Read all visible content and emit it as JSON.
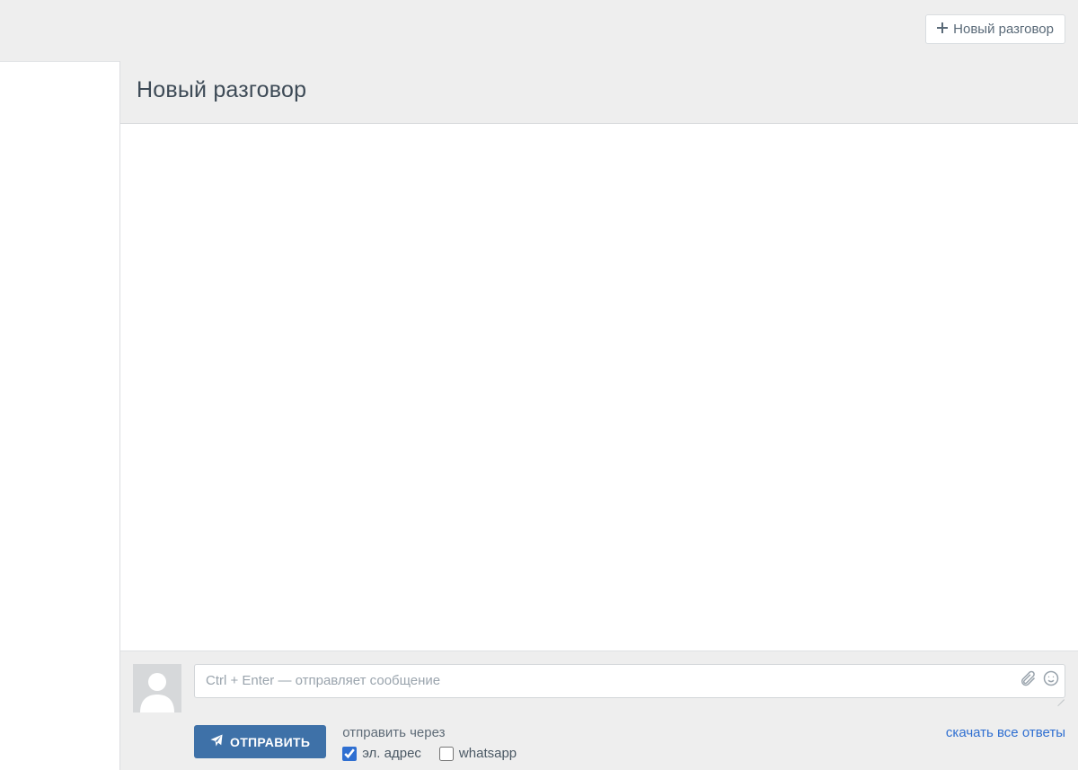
{
  "topbar": {
    "new_conversation_label": "Новый разговор"
  },
  "page_title": "Новый разговор",
  "composer": {
    "input_placeholder": "Ctrl + Enter — отправляет сообщение",
    "send_button_label": "ОТПРАВИТЬ",
    "send_via_label": "отправить через",
    "channels": {
      "email": {
        "label": "эл. адрес",
        "checked": true
      },
      "whatsapp": {
        "label": "whatsapp",
        "checked": false
      }
    },
    "download_all_label": "скачать все ответы"
  }
}
